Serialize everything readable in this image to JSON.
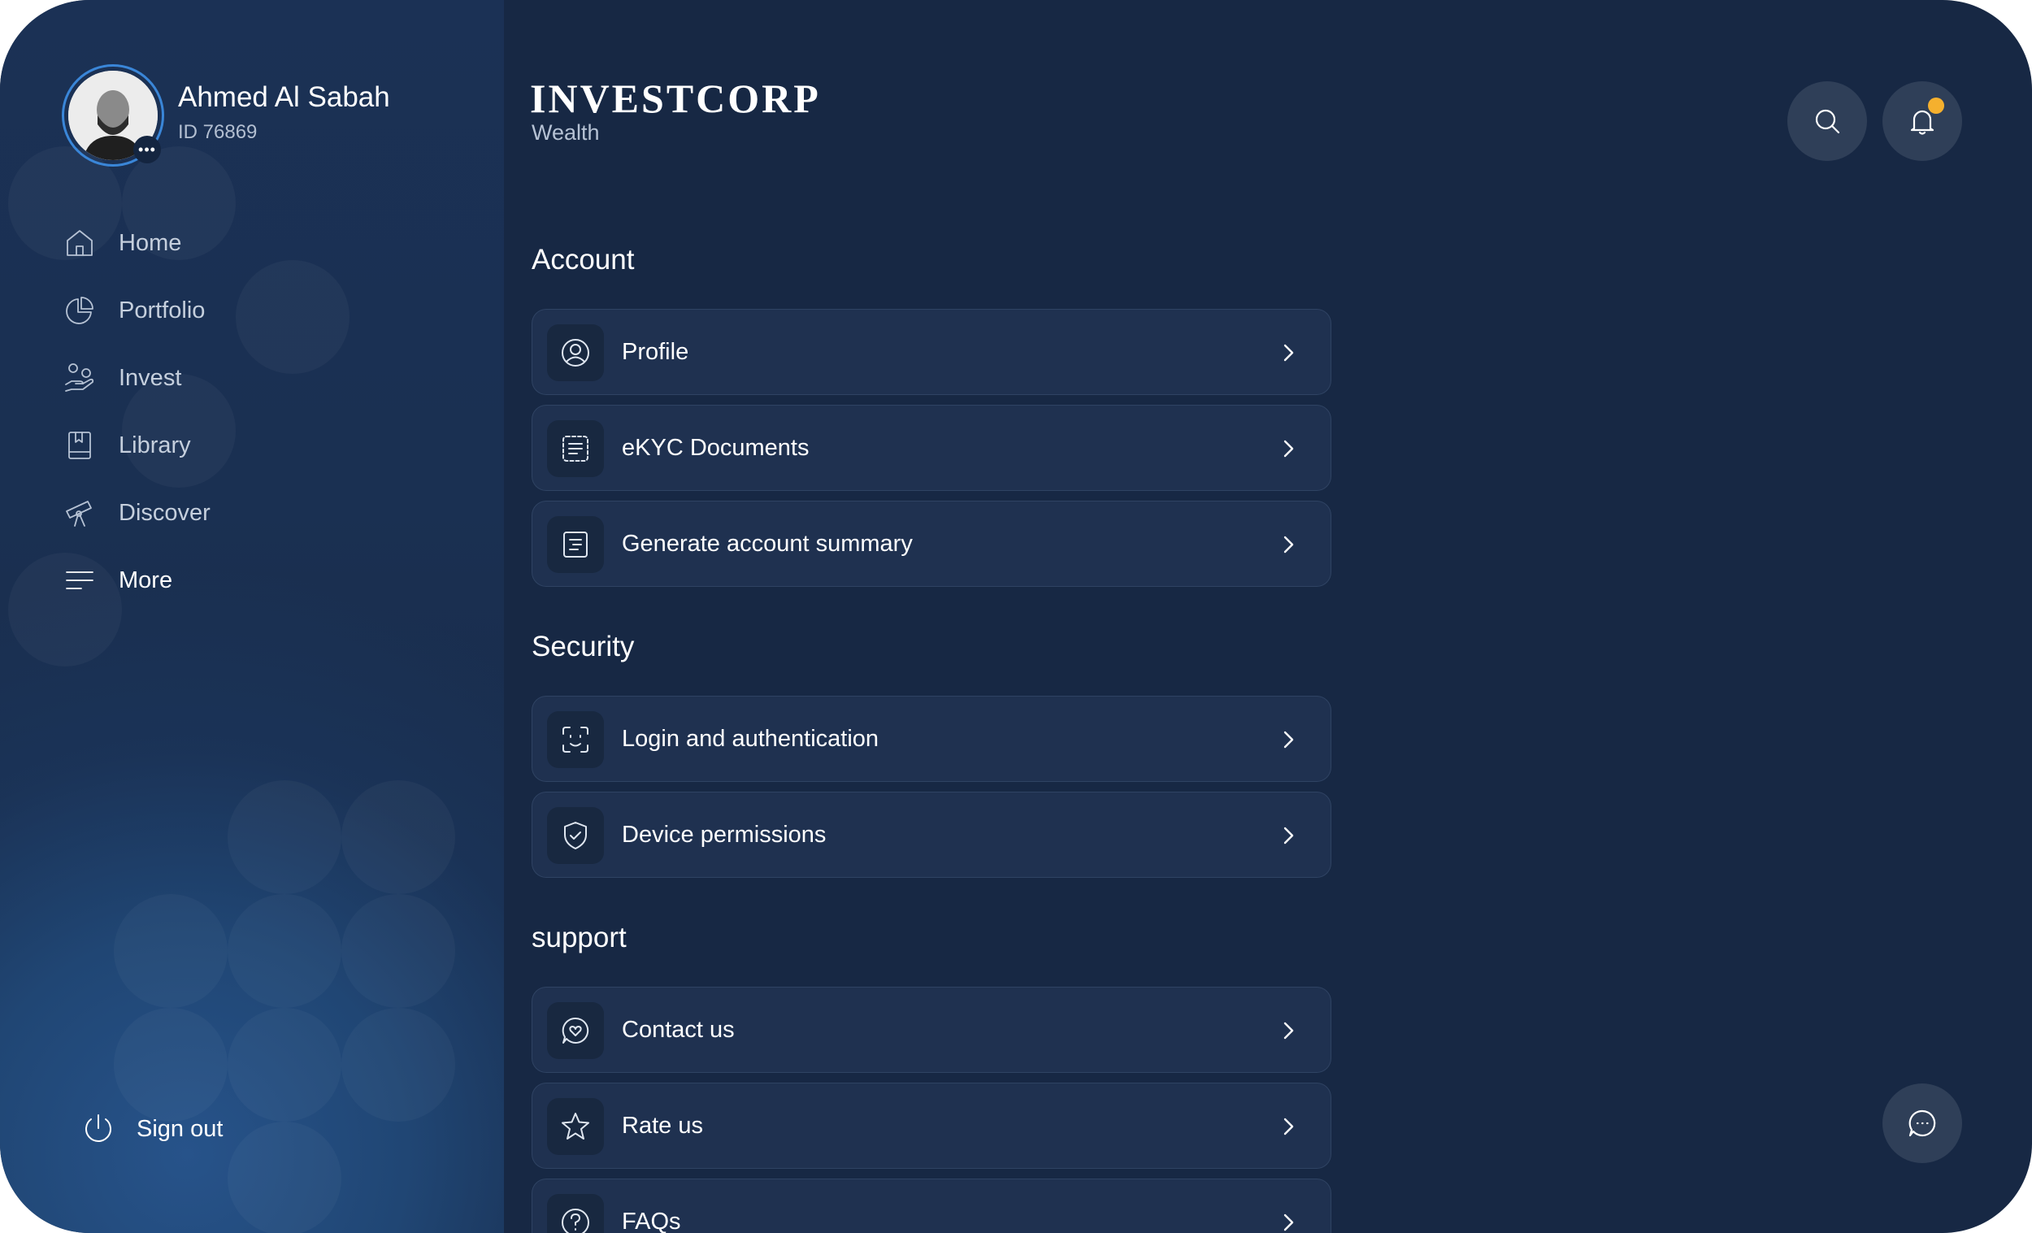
{
  "user": {
    "name": "Ahmed Al Sabah",
    "id": "ID 76869",
    "more_glyph": "•••"
  },
  "brand": {
    "logo": "INVESTCORP",
    "subtitle": "Wealth"
  },
  "nav": {
    "items": [
      {
        "label": "Home",
        "icon": "home-icon"
      },
      {
        "label": "Portfolio",
        "icon": "pie-chart-icon"
      },
      {
        "label": "Invest",
        "icon": "invest-hand-icon"
      },
      {
        "label": "Library",
        "icon": "book-icon"
      },
      {
        "label": "Discover",
        "icon": "telescope-icon"
      },
      {
        "label": "More",
        "icon": "menu-icon",
        "active": true
      }
    ],
    "signout_label": "Sign out"
  },
  "header": {
    "search_icon": "search-icon",
    "notification_icon": "bell-icon",
    "notification_dot_color": "#f5b02e"
  },
  "sections": {
    "account": {
      "title": "Account",
      "items": [
        {
          "label": "Profile",
          "icon": "user-circle-icon"
        },
        {
          "label": "eKYC Documents",
          "icon": "document-scan-icon"
        },
        {
          "label": "Generate account summary",
          "icon": "summary-icon"
        }
      ]
    },
    "security": {
      "title": "Security",
      "items": [
        {
          "label": "Login and authentication",
          "icon": "face-id-icon"
        },
        {
          "label": "Device permissions",
          "icon": "shield-check-icon"
        }
      ]
    },
    "support": {
      "title": "support",
      "items": [
        {
          "label": "Contact us",
          "icon": "chat-heart-icon"
        },
        {
          "label": "Rate us",
          "icon": "star-icon"
        },
        {
          "label": "FAQs",
          "icon": "question-icon"
        }
      ]
    }
  },
  "chat_fab_icon": "chat-bubble-icon",
  "colors": {
    "background": "#172844",
    "row_background": "#1f3150",
    "accent": "#3a86d8"
  }
}
